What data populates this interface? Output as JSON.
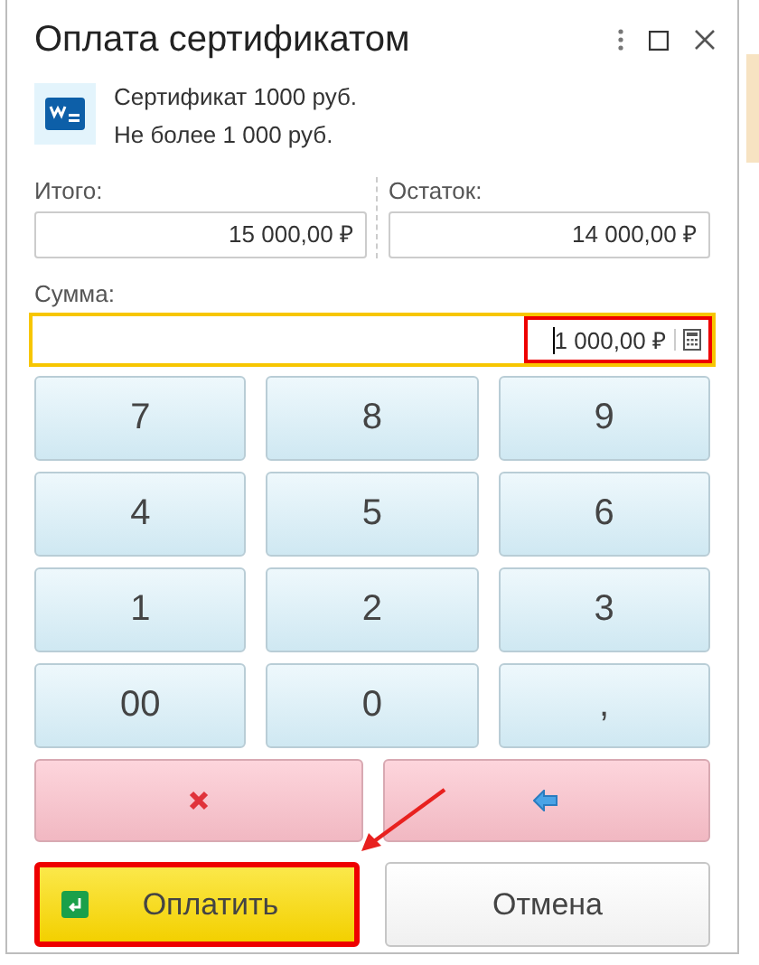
{
  "window": {
    "title": "Оплата сертификатом"
  },
  "certificate": {
    "name": "Сертификат 1000 руб.",
    "limit": "Не более 1 000 руб."
  },
  "totals": [
    {
      "label": "Итого:",
      "value": "15 000,00 ₽"
    },
    {
      "label": "Остаток:",
      "value": "14 000,00 ₽"
    }
  ],
  "amount": {
    "label": "Сумма:",
    "value": "1 000,00 ₽",
    "focused": true,
    "highlighted": true
  },
  "keypad": [
    "7",
    "8",
    "9",
    "4",
    "5",
    "6",
    "1",
    "2",
    "3",
    "00",
    "0",
    ","
  ],
  "actions": [
    {
      "kind": "clear"
    },
    {
      "kind": "backspace"
    }
  ],
  "buttons": [
    {
      "label": "Оплатить",
      "kind": "primary",
      "highlighted": true
    },
    {
      "label": "Отмена",
      "kind": "secondary",
      "highlighted": false
    }
  ]
}
